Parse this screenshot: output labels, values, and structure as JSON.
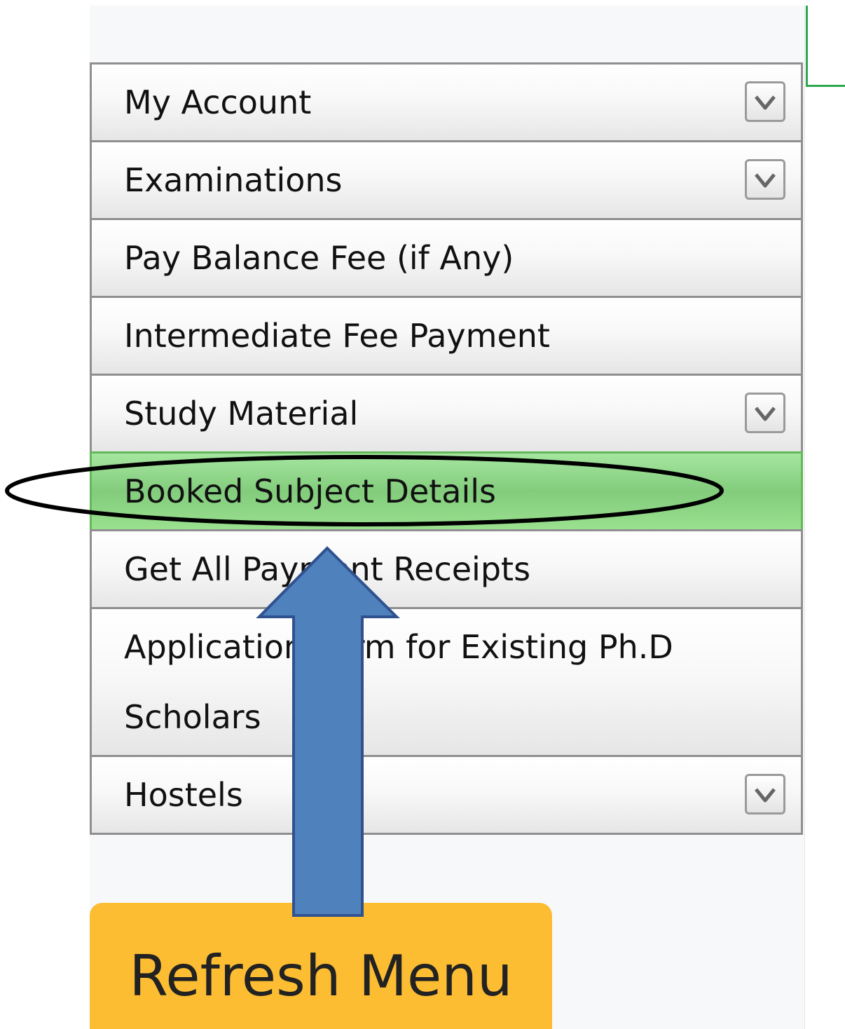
{
  "sidebar": {
    "items": [
      {
        "label": "My Account",
        "has_submenu": true,
        "icon": "chevron-down-icon"
      },
      {
        "label": "Examinations",
        "has_submenu": true,
        "icon": "chevron-down-icon"
      },
      {
        "label": "Pay Balance Fee (if Any)",
        "has_submenu": false
      },
      {
        "label": "Intermediate Fee Payment",
        "has_submenu": false
      },
      {
        "label": "Study Material",
        "has_submenu": true,
        "icon": "chevron-down-icon"
      },
      {
        "label": "Booked Subject Details",
        "has_submenu": false,
        "active": true
      },
      {
        "label": "Get All Payment Receipts",
        "has_submenu": false
      },
      {
        "label": "Application Form for Existing Ph.D Scholars",
        "has_submenu": false
      },
      {
        "label": "Hostels",
        "has_submenu": true,
        "icon": "chevron-down-icon"
      }
    ]
  },
  "refresh_button": {
    "label": "Refresh Menu"
  },
  "annotations": {
    "highlight": "ellipse-outline",
    "pointer": "up-arrow"
  },
  "colors": {
    "active_item": "#8fd888",
    "refresh_button": "#fcbd33",
    "arrow_fill": "#4f81bd",
    "arrow_stroke": "#2f528f",
    "corner_accent": "#2ea84f"
  }
}
